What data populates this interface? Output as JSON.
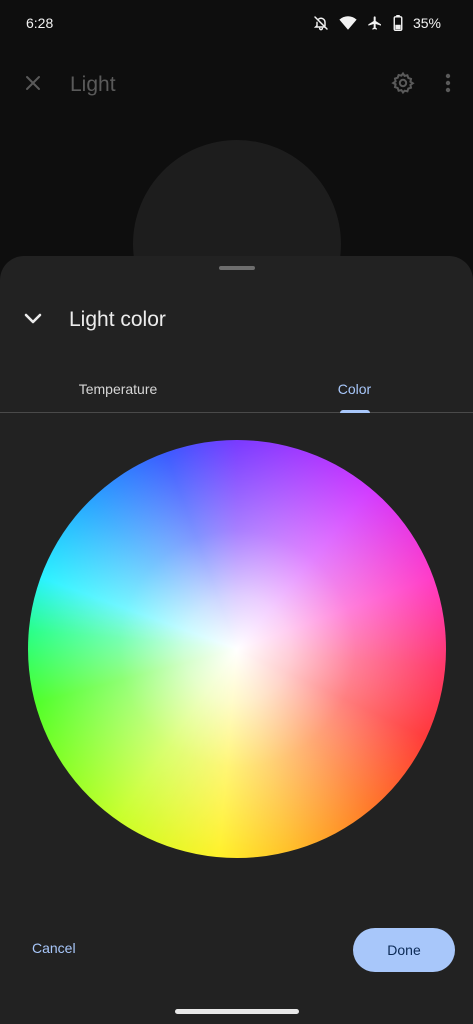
{
  "status_bar": {
    "time": "6:28",
    "battery": "35%",
    "icons": [
      "bell-off-icon",
      "wifi-icon",
      "airplane-icon",
      "battery-icon"
    ]
  },
  "app_bar": {
    "title": "Light",
    "icons": [
      "close-icon",
      "gear-icon",
      "more-vert-icon"
    ]
  },
  "sheet": {
    "title": "Light color",
    "collapse_icon": "chevron-down-icon",
    "tabs": [
      {
        "label": "Temperature",
        "selected": false
      },
      {
        "label": "Color",
        "selected": true
      }
    ],
    "cancel_label": "Cancel",
    "done_label": "Done"
  },
  "colors": {
    "accent": "#a8c7fa",
    "sheet_bg": "#222222",
    "page_bg": "#0e0e0e",
    "done_text": "#0b2a55"
  }
}
